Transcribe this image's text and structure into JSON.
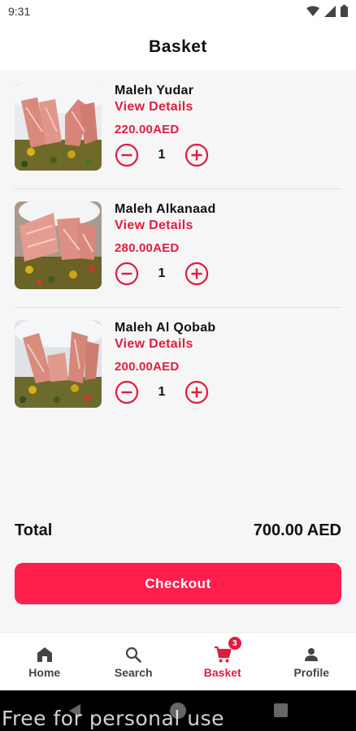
{
  "status_bar": {
    "time": "9:31"
  },
  "header": {
    "title": "Basket"
  },
  "items": [
    {
      "name": "Maleh Yudar",
      "details_label": "View Details",
      "price": "220.00AED",
      "quantity": "1"
    },
    {
      "name": "Maleh Alkanaad",
      "details_label": "View Details",
      "price": "280.00AED",
      "quantity": "1"
    },
    {
      "name": "Maleh Al Qobab",
      "details_label": "View Details",
      "price": "200.00AED",
      "quantity": "1"
    }
  ],
  "summary": {
    "total_label": "Total",
    "total_value": "700.00 AED"
  },
  "checkout_label": "Checkout",
  "bottom_nav": [
    {
      "label": "Home",
      "icon": "home-icon",
      "active": false
    },
    {
      "label": "Search",
      "icon": "search-icon",
      "active": false
    },
    {
      "label": "Basket",
      "icon": "cart-icon",
      "active": true,
      "badge": "3"
    },
    {
      "label": "Profile",
      "icon": "person-icon",
      "active": false
    }
  ],
  "watermark": "Free for personal use",
  "colors": {
    "accent": "#e11d3f",
    "button": "#ff1f4d",
    "background": "#f6f6f7"
  }
}
